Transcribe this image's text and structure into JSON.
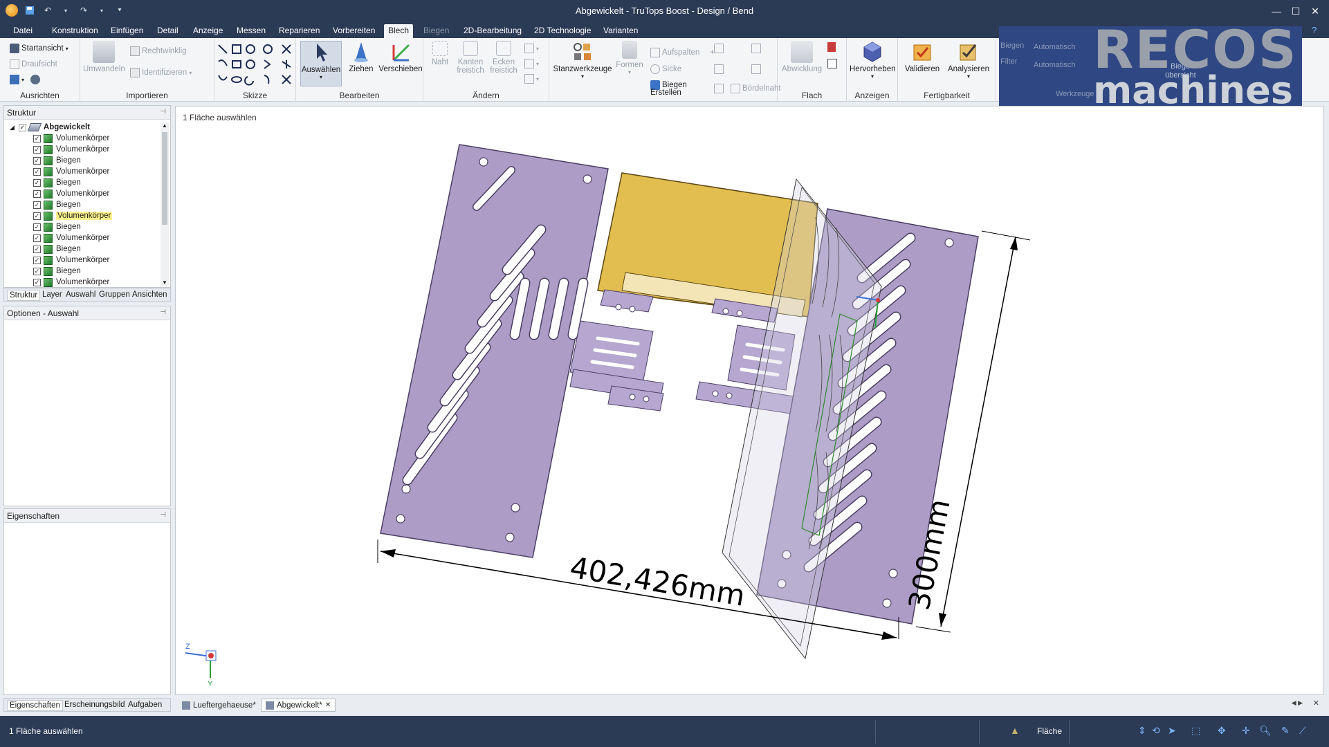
{
  "window": {
    "title": "Abgewickelt - TruTops Boost - Design / Bend",
    "buttons": [
      "minimize",
      "maximize",
      "close"
    ]
  },
  "quick_access": [
    "app-menu-icon",
    "save-icon",
    "undo-icon",
    "redo-icon",
    "customize-icon"
  ],
  "ribbon_tabs": [
    {
      "label": "Datei",
      "state": "normal"
    },
    {
      "label": "Konstruktion",
      "state": "normal"
    },
    {
      "label": "Einfügen",
      "state": "normal"
    },
    {
      "label": "Detail",
      "state": "normal"
    },
    {
      "label": "Anzeige",
      "state": "normal"
    },
    {
      "label": "Messen",
      "state": "normal"
    },
    {
      "label": "Reparieren",
      "state": "normal"
    },
    {
      "label": "Vorbereiten",
      "state": "normal"
    },
    {
      "label": "Blech",
      "state": "active"
    },
    {
      "label": "Biegen",
      "state": "disabled"
    },
    {
      "label": "2D-Bearbeitung",
      "state": "normal"
    },
    {
      "label": "2D Technologie",
      "state": "normal"
    },
    {
      "label": "Varianten",
      "state": "normal"
    }
  ],
  "ribbon": {
    "ausrichten": {
      "label": "Ausrichten",
      "startansicht": "Startansicht",
      "draufsicht": "Draufsicht"
    },
    "importieren": {
      "label": "Importieren",
      "umwandeln": "Umwandeln",
      "rechtwinklig": "Rechtwinklig",
      "identifizieren": "Identifizieren"
    },
    "skizze": {
      "label": "Skizze"
    },
    "bearbeiten": {
      "label": "Bearbeiten",
      "auswaehlen": "Auswählen",
      "ziehen": "Ziehen",
      "verschieben": "Verschieben"
    },
    "aendern": {
      "label": "Ändern",
      "naht": "Naht",
      "kanten": "Kanten",
      "kanten2": "freistich",
      "ecken": "Ecken",
      "ecken2": "freistich"
    },
    "stanz": {
      "stanzwerkzeuge": "Stanzwerkzeuge",
      "formen": "Formen",
      "aufspalten": "Aufspalten",
      "sicke": "Sicke",
      "biegen_erstellen": "Biegen",
      "biegen_erstellen2": "Erstellen",
      "boerdelnaht": "Bördelnaht"
    },
    "flach": {
      "label": "Flach",
      "abwicklung": "Abwicklung"
    },
    "anzeigen": {
      "label": "Anzeigen",
      "hervorheben": "Hervorheben"
    },
    "fertigbarkeit": {
      "label": "Fertigbarkeit",
      "validieren": "Validieren",
      "analysieren": "Analysieren"
    },
    "werkzeug": {
      "label": "Werkzeuge",
      "biegen": "Biegen",
      "filter": "Filter",
      "auto1": "Automatisch",
      "auto2": "Automatisch",
      "biege": "Biege-",
      "uebersicht": "übersicht"
    }
  },
  "logo": {
    "line1": "RECOS",
    "line2": "machines"
  },
  "structure_panel": {
    "title": "Struktur",
    "root": "Abgewickelt",
    "items": [
      {
        "label": "Volumenkörper",
        "highlight": false
      },
      {
        "label": "Volumenkörper",
        "highlight": false
      },
      {
        "label": "Biegen",
        "highlight": false
      },
      {
        "label": "Volumenkörper",
        "highlight": false
      },
      {
        "label": "Biegen",
        "highlight": false
      },
      {
        "label": "Volumenkörper",
        "highlight": false
      },
      {
        "label": "Biegen",
        "highlight": false
      },
      {
        "label": "Volumenkörper",
        "highlight": true
      },
      {
        "label": "Biegen",
        "highlight": false
      },
      {
        "label": "Volumenkörper",
        "highlight": false
      },
      {
        "label": "Biegen",
        "highlight": false
      },
      {
        "label": "Volumenkörper",
        "highlight": false
      },
      {
        "label": "Biegen",
        "highlight": false
      },
      {
        "label": "Volumenkörper",
        "highlight": false
      }
    ],
    "tabs": [
      "Struktur",
      "Layer",
      "Auswahl",
      "Gruppen",
      "Ansichten"
    ]
  },
  "options_panel": {
    "title": "Optionen - Auswahl"
  },
  "properties_panel": {
    "title": "Eigenschaften",
    "tabs": [
      "Eigenschaften",
      "Erscheinungsbild",
      "Aufgaben"
    ]
  },
  "viewport": {
    "hint": "1 Fläche auswählen",
    "dimension_width": "402,426mm",
    "dimension_height": "300mm",
    "axes": {
      "z": "Z",
      "y": "Y"
    }
  },
  "doc_tabs": [
    {
      "label": "Lueftergehaeuse*",
      "active": false
    },
    {
      "label": "Abgewickelt*",
      "active": true
    }
  ],
  "status": {
    "message": "1 Fläche auswählen",
    "selection_mode": "Fläche"
  },
  "colors": {
    "titlebar": "#2b3a55",
    "panel_purple": "#ad9dc6",
    "panel_yellow": "#e2bd4f",
    "logo_bg": "#2f4883"
  }
}
